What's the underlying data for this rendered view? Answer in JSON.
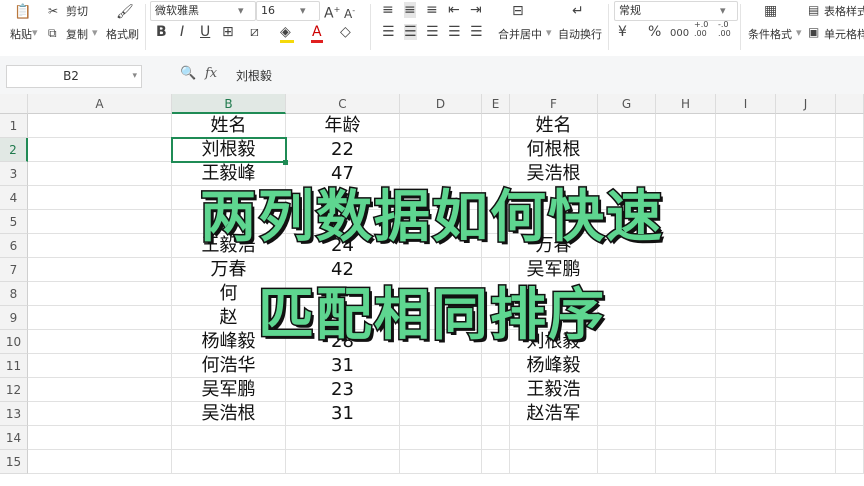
{
  "toolbar": {
    "paste_label": "粘贴",
    "cut_label": "剪切",
    "copy_label": "复制",
    "format_painter_label": "格式刷",
    "font_name": "微软雅黑",
    "font_size": "16",
    "merge_label": "合并居中",
    "wrap_label": "自动换行",
    "number_format": "常规",
    "cond_format_label": "条件格式",
    "table_style_label": "表格样式",
    "cell_style_label": "单元格样式",
    "currency_symbol": "¥",
    "percent_symbol": "%",
    "thousands_symbol": "000",
    "inc_decimal_symbol": "+.0 .00",
    "dec_decimal_symbol": "-.0 .00"
  },
  "formula_bar": {
    "cell_ref": "B2",
    "fx_label": "fx",
    "content": "刘根毅"
  },
  "columns": [
    "A",
    "B",
    "C",
    "D",
    "E",
    "F",
    "G",
    "H",
    "I",
    "J"
  ],
  "rows": [
    "1",
    "2",
    "3",
    "4",
    "5",
    "6",
    "7",
    "8",
    "9",
    "10",
    "11",
    "12",
    "13",
    "14",
    "15"
  ],
  "cells": {
    "b_header": "姓名",
    "c_header": "年龄",
    "f_header": "姓名",
    "b": [
      "刘根毅",
      "王毅峰",
      "",
      "",
      "王毅浩",
      "万春",
      "何",
      "赵",
      "杨峰毅",
      "何浩华",
      "吴军鹏",
      "吴浩根"
    ],
    "c": [
      "22",
      "47",
      "",
      "",
      "24",
      "42",
      "",
      "",
      "28",
      "31",
      "23",
      "31"
    ],
    "f": [
      "何根根",
      "吴浩根",
      "",
      "",
      "万春",
      "吴军鹏",
      "",
      "",
      "刘根毅",
      "杨峰毅",
      "王毅浩",
      "赵浩军"
    ]
  },
  "overlay": {
    "line1": "两列数据如何快速",
    "line2": "匹配相同排序"
  },
  "colors": {
    "accent": "#1f8b55",
    "overlay_fill": "#5ed690"
  }
}
